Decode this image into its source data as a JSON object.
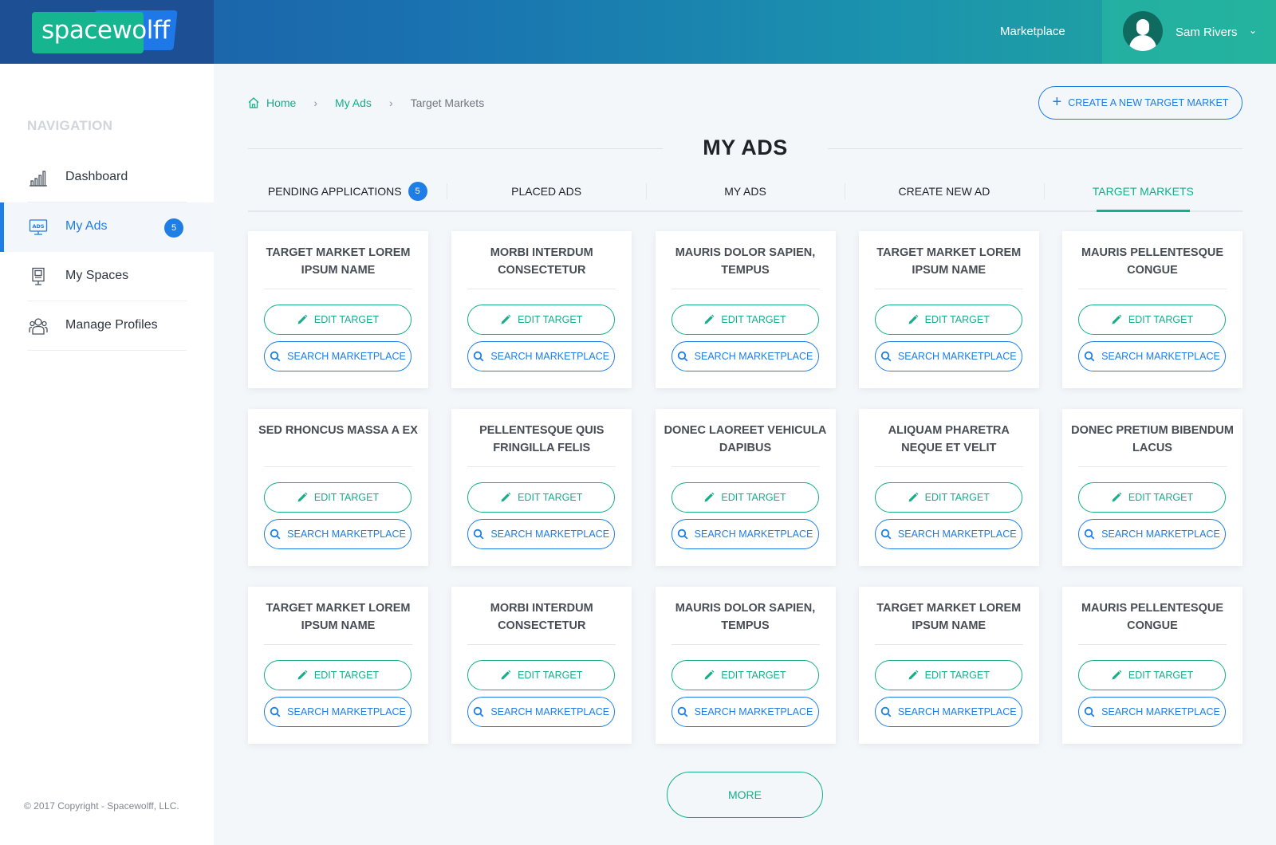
{
  "brand": {
    "logo_text": "spacewolff"
  },
  "header": {
    "marketplace_link": "Marketplace",
    "user": {
      "name": "Sam Rivers"
    }
  },
  "sidebar": {
    "title": "NAVIGATION",
    "items": [
      {
        "label": "Dashboard",
        "icon": "bar-chart-icon"
      },
      {
        "label": "My Ads",
        "icon": "ads-icon",
        "badge": "5",
        "active": true
      },
      {
        "label": "My Spaces",
        "icon": "billboard-icon"
      },
      {
        "label": "Manage Profiles",
        "icon": "users-icon"
      }
    ],
    "copyright": "© 2017 Copyright - Spacewolff, LLC."
  },
  "breadcrumb": [
    "Home",
    "My Ads",
    "Target Markets"
  ],
  "create_button": "CREATE A NEW TARGET MARKET",
  "page_title": "MY ADS",
  "tabs": [
    {
      "label": "PENDING APPLICATIONS",
      "badge": "5"
    },
    {
      "label": "PLACED ADS"
    },
    {
      "label": "MY ADS"
    },
    {
      "label": "CREATE NEW AD"
    },
    {
      "label": "TARGET MARKETS",
      "active": true
    }
  ],
  "card_actions": {
    "edit": "EDIT TARGET",
    "search": "SEARCH MARKETPLACE"
  },
  "cards": [
    "TARGET MARKET  LOREM IPSUM NAME",
    "MORBI INTERDUM CONSECTETUR",
    "MAURIS DOLOR SAPIEN, TEMPUS",
    "TARGET MARKET  LOREM IPSUM NAME",
    "MAURIS PELLENTESQUE CONGUE",
    "SED RHONCUS MASSA A EX",
    "PELLENTESQUE QUIS FRINGILLA FELIS",
    "DONEC LAOREET VEHICULA DAPIBUS",
    "ALIQUAM PHARETRA NEQUE ET VELIT",
    "DONEC PRETIUM BIBENDUM LACUS",
    "TARGET MARKET  LOREM IPSUM NAME",
    "MORBI INTERDUM CONSECTETUR",
    "MAURIS DOLOR SAPIEN, TEMPUS",
    "TARGET MARKET  LOREM IPSUM NAME",
    "MAURIS PELLENTESQUE CONGUE"
  ],
  "more_button": "MORE",
  "colors": {
    "accent_green": "#14ae8a",
    "accent_blue": "#1e7ee6",
    "header_start": "#1d5aa6",
    "header_end": "#21a89c"
  }
}
